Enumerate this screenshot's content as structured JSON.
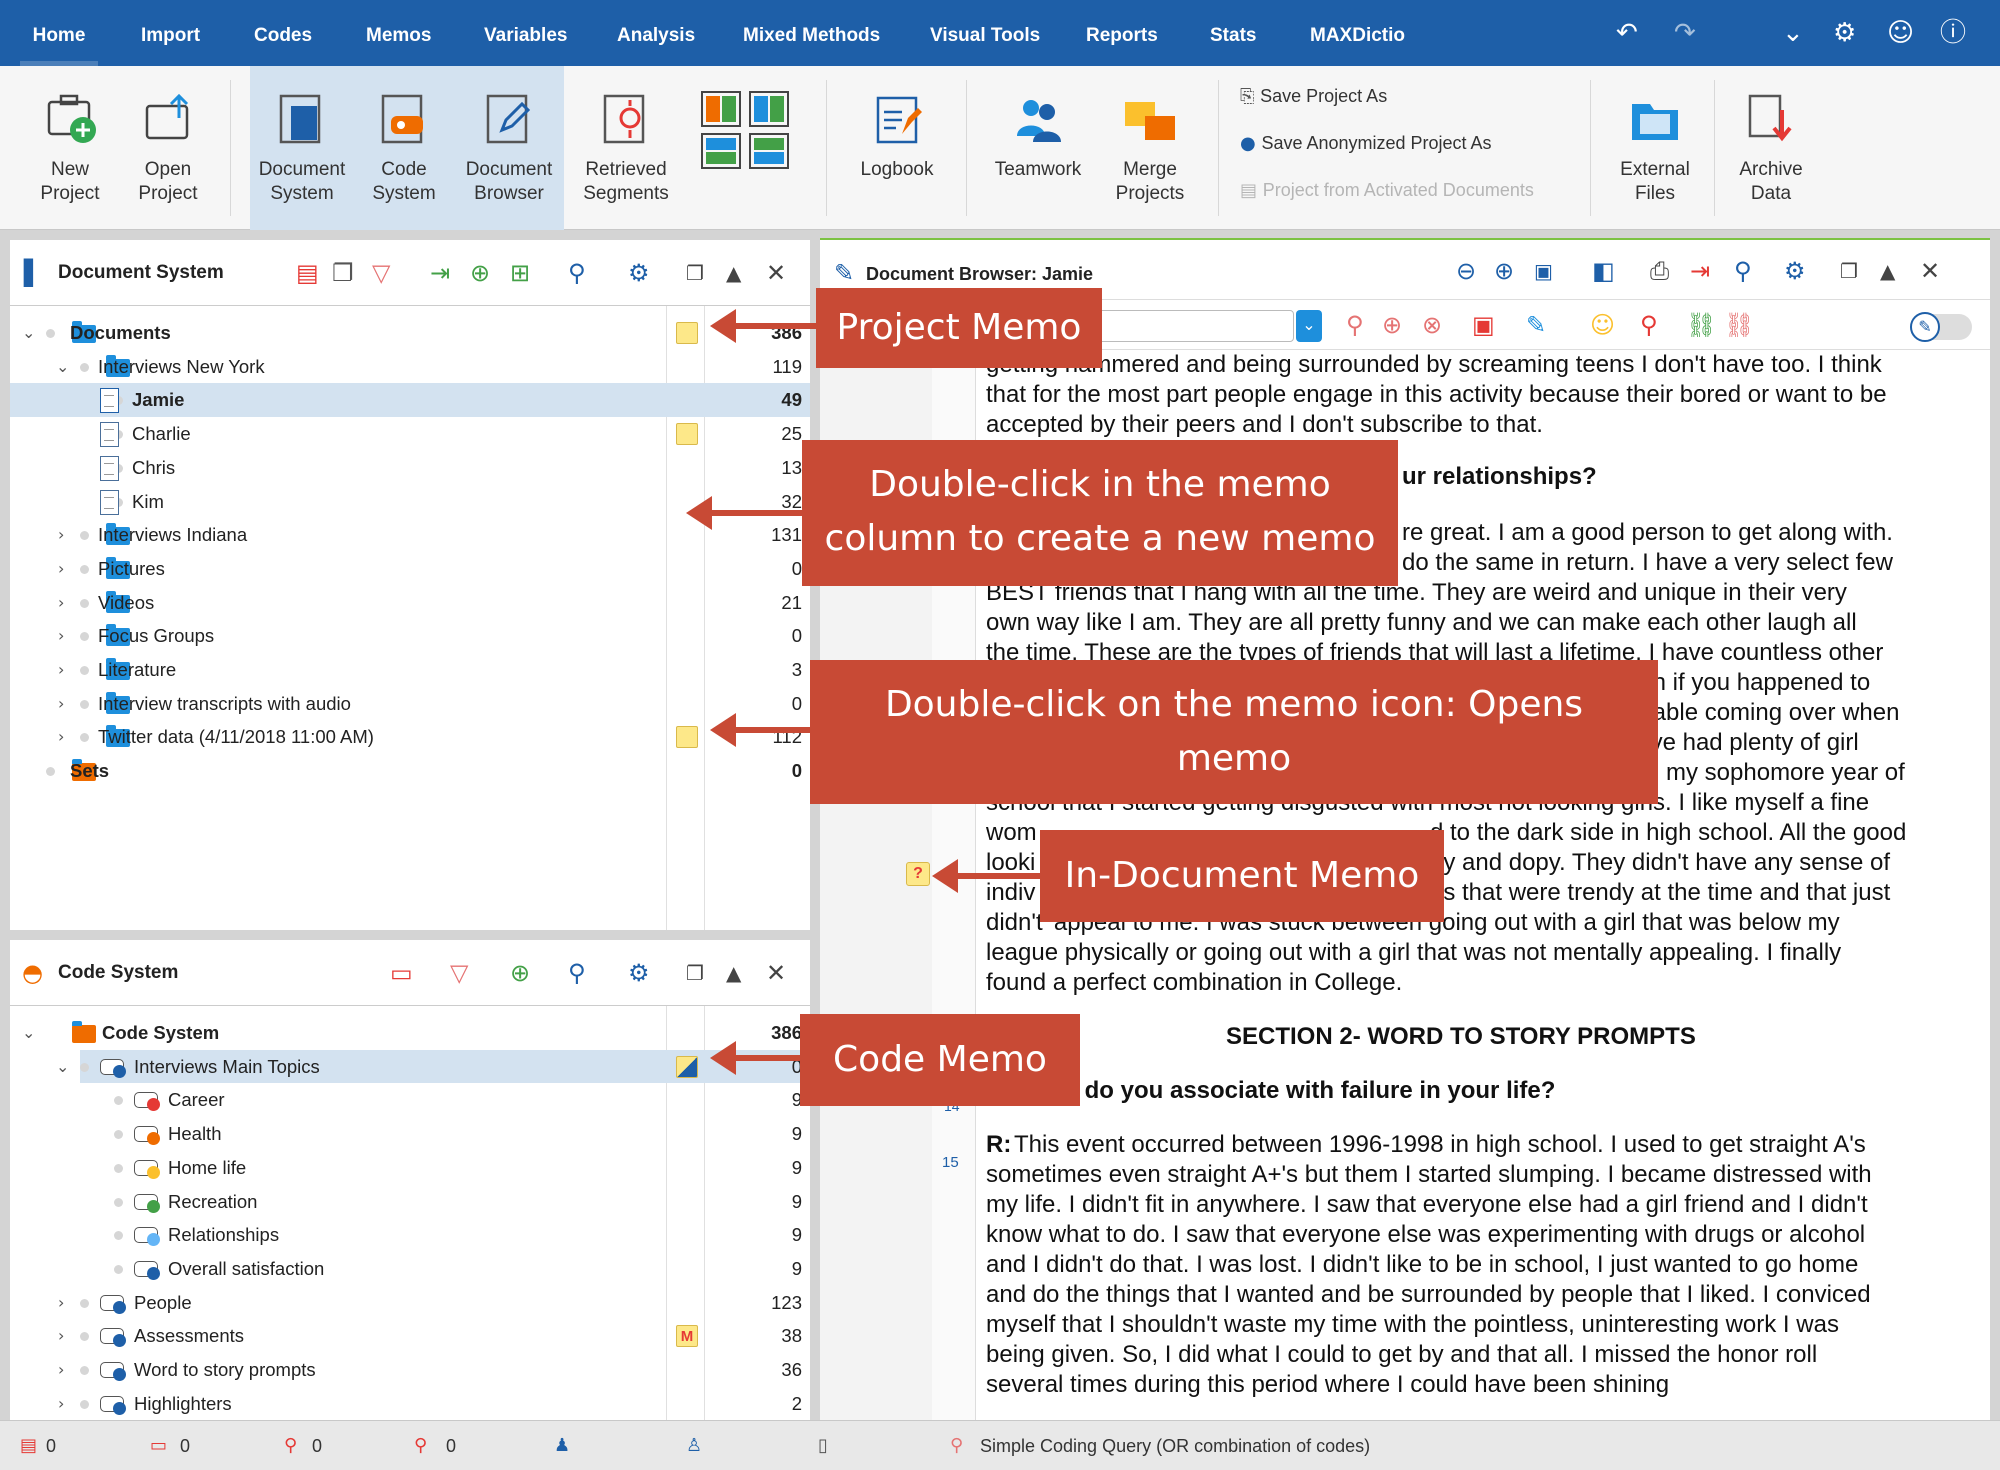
{
  "ribbon": {
    "tabs": [
      "Home",
      "Import",
      "Codes",
      "Memos",
      "Variables",
      "Analysis",
      "Mixed Methods",
      "Visual Tools",
      "Reports",
      "Stats",
      "MAXDictio"
    ],
    "right_icons": [
      "undo-icon",
      "redo-icon",
      "chevron-down-icon",
      "gear-icon",
      "smiley-icon",
      "help-icon"
    ]
  },
  "toolbar": {
    "new_project": "New\nProject",
    "open_project": "Open\nProject",
    "document_system": "Document\nSystem",
    "code_system": "Code\nSystem",
    "document_browser": "Document\nBrowser",
    "retrieved_segments": "Retrieved\nSegments",
    "logbook": "Logbook",
    "teamwork": "Teamwork",
    "merge_projects": "Merge\nProjects",
    "save_project_as": "Save Project As",
    "save_anonymized": "Save Anonymized Project As",
    "project_from_activated": "Project from Activated Documents",
    "external_files": "External\nFiles",
    "archive_data": "Archive\nData"
  },
  "document_system": {
    "title": "Document System",
    "rows": [
      {
        "label": "Documents",
        "count": "386",
        "bold": true
      },
      {
        "label": "Interviews New York",
        "count": "119"
      },
      {
        "label": "Jamie",
        "count": "49",
        "bold": true
      },
      {
        "label": "Charlie",
        "count": "25"
      },
      {
        "label": "Chris",
        "count": "13"
      },
      {
        "label": "Kim",
        "count": "32"
      },
      {
        "label": "Interviews Indiana",
        "count": "131"
      },
      {
        "label": "Pictures",
        "count": "0"
      },
      {
        "label": "Videos",
        "count": "21"
      },
      {
        "label": "Focus Groups",
        "count": "0"
      },
      {
        "label": "Literature",
        "count": "3"
      },
      {
        "label": "Interview transcripts with audio",
        "count": "0"
      },
      {
        "label": "Twitter data (4/11/2018 11:00 AM)",
        "count": "112"
      },
      {
        "label": "Sets",
        "count": "0",
        "bold": true
      }
    ]
  },
  "code_system": {
    "title": "Code System",
    "rows": [
      {
        "label": "Code System",
        "count": "386",
        "bold": true
      },
      {
        "label": "Interviews Main Topics",
        "count": "0"
      },
      {
        "label": "Career",
        "count": "9"
      },
      {
        "label": "Health",
        "count": "9"
      },
      {
        "label": "Home life",
        "count": "9"
      },
      {
        "label": "Recreation",
        "count": "9"
      },
      {
        "label": "Relationships",
        "count": "9"
      },
      {
        "label": "Overall satisfaction",
        "count": "9"
      },
      {
        "label": "People",
        "count": "123"
      },
      {
        "label": "Assessments",
        "count": "38"
      },
      {
        "label": "Word to story prompts",
        "count": "36"
      },
      {
        "label": "Highlighters",
        "count": "2"
      }
    ],
    "colors": {
      "career": "#e53935",
      "health": "#ef6c00",
      "homelife": "#fbc02d",
      "recreation": "#43a047",
      "relationships": "#64b5f6",
      "overall": "#1e5fa8",
      "default": "#1e5fa8"
    }
  },
  "document_browser": {
    "title": "Document Browser: Jamie",
    "line_numbers": [
      "14",
      "15"
    ],
    "text": [
      "getting hammered and being surrounded by screaming teens I don't have too. I think",
      "that for the most part people engage in this activity because their bored or want to be",
      "accepted by their peers and I don't subscribe to that.",
      "ur relationships?",
      "re great. I am a good person to get along with.",
      "do the same in return. I have a very select few",
      "BEST friends that I hang with all the time. They are weird and unique in their very",
      "own way like I am. They are all pretty funny and we can make each other laugh all",
      "the time. These are the types of friends that will last a lifetime. I have countless other",
      "th if you happened to",
      "table coming over when",
      "'ve had plenty of girl",
      "n my sophomore year of",
      "school that I started getting disgusted with most hot looking girls. I like myself a fine",
      "wom",
      "d to the dark side in high school. All the good",
      "looki",
      "dy and dopy. They didn't have any sense of",
      "indiv",
      "gs that were trendy at the time and that just",
      "didn't' appeal to me. I was stuck between going out with a girl that was below my",
      "league physically or going out with a girl that was not mentally appealing. I finally",
      "found a perfect combination in College.",
      "SECTION 2- WORD TO STORY PROMPTS",
      "Q: What do you associate with failure in your life?",
      "R:",
      " This event occurred between 1996-1998 in high school. I used to get straight A's",
      "sometimes even straight A+'s but them I started slumping. I became distressed with",
      "my life. I didn't fit in anywhere. I saw that everyone else had a girl friend and I didn't",
      "know what to do. I saw that everyone else was experimenting with drugs or alcohol",
      "and I didn't do that. I was lost. I didn't like to be in school, I just wanted to go home",
      "and do the things that I wanted and be surrounded by people that I liked. I conviced",
      "myself that I shouldn't waste my time with the pointless, uninteresting work I was",
      "being given. So, I did what I could to get by and that all. I missed the honor roll",
      "several times during this period where I could have been shining"
    ]
  },
  "callouts": {
    "project_memo": "Project Memo",
    "double_click_memo_col": "Double-click in the memo\ncolumn to create a new memo",
    "double_click_memo_icon": "Double-click on the memo icon: Opens\nmemo",
    "in_document_memo": "In-Document Memo",
    "code_memo": "Code Memo"
  },
  "statusbar": {
    "counts": [
      "0",
      "0",
      "0",
      "0"
    ],
    "query": "Simple Coding Query (OR combination of codes)"
  }
}
